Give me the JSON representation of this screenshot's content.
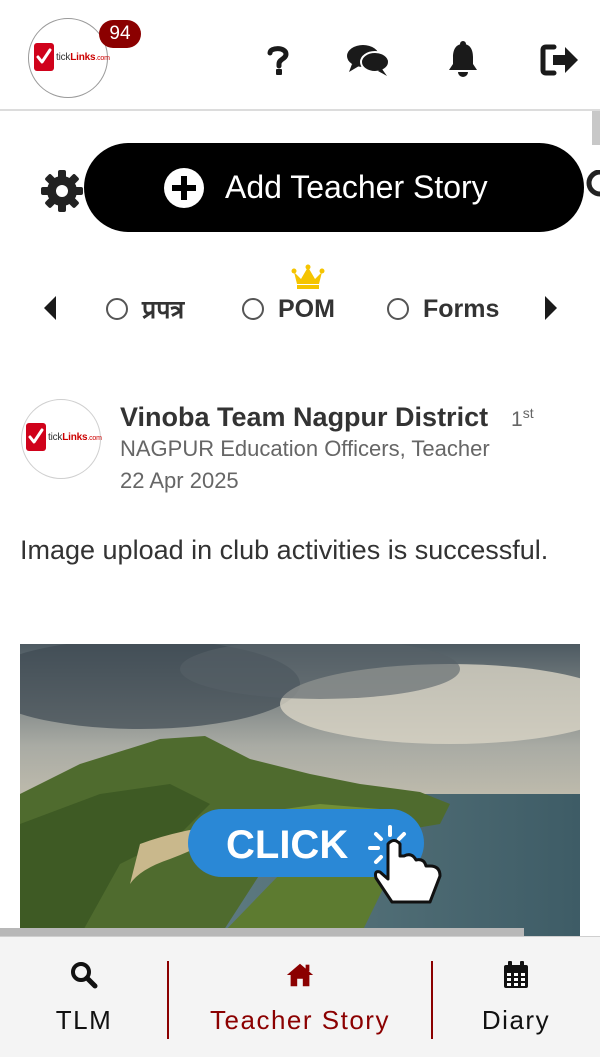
{
  "header": {
    "logo_text_a": "tick",
    "logo_text_b": "Links",
    "logo_text_c": ".com",
    "notification_count": "94",
    "icons": [
      "help-icon",
      "chat-icon",
      "bell-icon",
      "logout-icon"
    ]
  },
  "toolbar": {
    "add_story_label": "Add Teacher Story",
    "icons": [
      "gear-icon",
      "plus-circle-icon",
      "search-icon"
    ]
  },
  "tabs": {
    "items": [
      {
        "label": "प्रपत्र",
        "selected": false
      },
      {
        "label": "POM",
        "selected": false,
        "badge_icon": "crown-icon"
      },
      {
        "label": "Forms",
        "selected": false
      }
    ]
  },
  "post": {
    "author": "Vinoba Team Nagpur District",
    "degree": "1",
    "degree_suffix": "st",
    "role": "NAGPUR Education Officers, Teacher",
    "date": "22 Apr 2025",
    "text": "Image upload in club activities is successful.",
    "image_button_text": "CLICK"
  },
  "bottom_nav": {
    "items": [
      {
        "label": "TLM",
        "icon": "search-icon",
        "active": false
      },
      {
        "label": "Teacher Story",
        "icon": "home-icon",
        "active": true
      },
      {
        "label": "Diary",
        "icon": "calendar-icon",
        "active": false
      }
    ]
  },
  "colors": {
    "accent": "#8b0000",
    "brand_red": "#d0021b",
    "button_bg": "#000000",
    "click_button": "#2a88d6"
  }
}
